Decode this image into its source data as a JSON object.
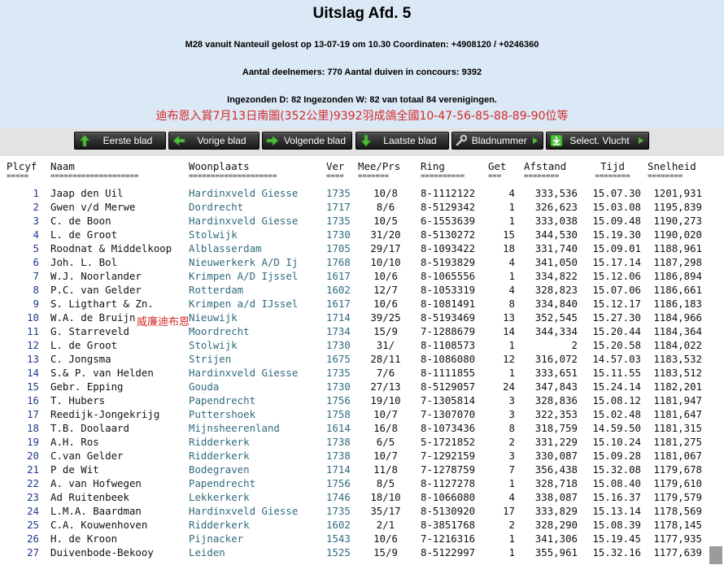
{
  "header": {
    "title": "Uitslag Afd. 5",
    "line1": "M28 vanuit Nanteuil gelost op 13-07-19 om 10.30 Coordinaten: +4908120 / +0246360",
    "line2": "Aantal deelnemers: 770 Aantal duiven in concours: 9392",
    "line3": "Ingezonden D: 82 Ingezonden W: 82 van totaal 84 verenigingen.",
    "chinese_note": "迪布恩入賞7月13日南圖(352公里)9392羽成鴿全國10-47-56-85-88-89-90位等"
  },
  "nav": {
    "first": "Eerste blad",
    "prev": "Vorige blad",
    "next": "Volgende blad",
    "last": "Laatste blad",
    "page_number": "Bladnummer",
    "select_flight": "Select. Vlucht"
  },
  "columns": {
    "headers": [
      "Plcyf",
      "Naam",
      "Woonplaats",
      "Ver",
      "Mee/Prs",
      "Ring",
      "Get",
      "Afstand",
      "Tijd",
      "Snelheid"
    ],
    "separators": [
      "=====",
      "====================",
      "====================",
      "====",
      "=======",
      "==========",
      "===",
      "========",
      "========",
      "========"
    ]
  },
  "rows": [
    [
      "1",
      "Jaap den Uil",
      "Hardinxveld Giesse",
      "1735",
      "10/8",
      "8-1112122",
      "4",
      "333,536",
      "15.07.30",
      "1201,931"
    ],
    [
      "2",
      "Gwen v/d Merwe",
      "Dordrecht",
      "1717",
      "8/6",
      "8-5129342",
      "1",
      "326,623",
      "15.03.08",
      "1195,839"
    ],
    [
      "3",
      "C. de Boon",
      "Hardinxveld Giesse",
      "1735",
      "10/5",
      "6-1553639",
      "1",
      "333,038",
      "15.09.48",
      "1190,273"
    ],
    [
      "4",
      "L. de Groot",
      "Stolwijk",
      "1730",
      "31/20",
      "8-5130272",
      "15",
      "344,530",
      "15.19.30",
      "1190,020"
    ],
    [
      "5",
      "Roodnat & Middelkoop",
      "Alblasserdam",
      "1705",
      "29/17",
      "8-1093422",
      "18",
      "331,740",
      "15.09.01",
      "1188,961"
    ],
    [
      "6",
      "Joh. L. Bol",
      "Nieuwerkerk A/D Ij",
      "1768",
      "10/10",
      "8-5193829",
      "4",
      "341,050",
      "15.17.14",
      "1187,298"
    ],
    [
      "7",
      "W.J. Noorlander",
      "Krimpen A/D Ijssel",
      "1617",
      "10/6",
      "8-1065556",
      "1",
      "334,822",
      "15.12.06",
      "1186,894"
    ],
    [
      "8",
      "P.C. van Gelder",
      "Rotterdam",
      "1602",
      "12/7",
      "8-1053319",
      "4",
      "328,823",
      "15.07.06",
      "1186,661"
    ],
    [
      "9",
      "S. Ligthart & Zn.",
      "Krimpen a/d IJssel",
      "1617",
      "10/6",
      "8-1081491",
      "8",
      "334,840",
      "15.12.17",
      "1186,183"
    ],
    [
      "10",
      "W.A. de Bruijn",
      "Nieuwijk",
      "1714",
      "39/25",
      "8-5193469",
      "13",
      "352,545",
      "15.27.30",
      "1184,966"
    ],
    [
      "11",
      "G. Starreveld",
      "Moordrecht",
      "1734",
      "15/9",
      "7-1288679",
      "14",
      "344,334",
      "15.20.44",
      "1184,364"
    ],
    [
      "12",
      "L. de Groot",
      "Stolwijk",
      "1730",
      "31/",
      "8-1108573",
      "1",
      "2",
      "15.20.58",
      "1184,022"
    ],
    [
      "13",
      "C. Jongsma",
      "Strijen",
      "1675",
      "28/11",
      "8-1086080",
      "12",
      "316,072",
      "14.57.03",
      "1183,532"
    ],
    [
      "14",
      "S.& P. van Helden",
      "Hardinxveld Giesse",
      "1735",
      "7/6",
      "8-1111855",
      "1",
      "333,651",
      "15.11.55",
      "1183,512"
    ],
    [
      "15",
      "Gebr. Epping",
      "Gouda",
      "1730",
      "27/13",
      "8-5129057",
      "24",
      "347,843",
      "15.24.14",
      "1182,201"
    ],
    [
      "16",
      "T. Hubers",
      "Papendrecht",
      "1756",
      "19/10",
      "7-1305814",
      "3",
      "328,836",
      "15.08.12",
      "1181,947"
    ],
    [
      "17",
      "Reedijk-Jongekrijg",
      "Puttershoek",
      "1758",
      "10/7",
      "7-1307070",
      "3",
      "322,353",
      "15.02.48",
      "1181,647"
    ],
    [
      "18",
      "T.B. Doolaard",
      "Mijnsheerenland",
      "1614",
      "16/8",
      "8-1073436",
      "8",
      "318,759",
      "14.59.50",
      "1181,315"
    ],
    [
      "19",
      "A.H. Ros",
      "Ridderkerk",
      "1738",
      "6/5",
      "5-1721852",
      "2",
      "331,229",
      "15.10.24",
      "1181,275"
    ],
    [
      "20",
      "C.van Gelder",
      "Ridderkerk",
      "1738",
      "10/7",
      "7-1292159",
      "3",
      "330,087",
      "15.09.28",
      "1181,067"
    ],
    [
      "21",
      "P de Wit",
      "Bodegraven",
      "1714",
      "11/8",
      "7-1278759",
      "7",
      "356,438",
      "15.32.08",
      "1179,678"
    ],
    [
      "22",
      "A. van Hofwegen",
      "Papendrecht",
      "1756",
      "8/5",
      "8-1127278",
      "1",
      "328,718",
      "15.08.40",
      "1179,610"
    ],
    [
      "23",
      "Ad Ruitenbeek",
      "Lekkerkerk",
      "1746",
      "18/10",
      "8-1066080",
      "4",
      "338,087",
      "15.16.37",
      "1179,579"
    ],
    [
      "24",
      "L.M.A. Baardman",
      "Hardinxveld Giesse",
      "1735",
      "35/17",
      "8-5130920",
      "17",
      "333,829",
      "15.13.14",
      "1178,569"
    ],
    [
      "25",
      "C.A. Kouwenhoven",
      "Ridderkerk",
      "1602",
      "2/1",
      "8-3851768",
      "2",
      "328,290",
      "15.08.39",
      "1178,145"
    ],
    [
      "26",
      "H. de Kroon",
      "Pijnacker",
      "1543",
      "10/6",
      "7-1216316",
      "1",
      "341,306",
      "15.19.45",
      "1177,935"
    ],
    [
      "27",
      "Duivenbode-Bekooy",
      "Leiden",
      "1525",
      "15/9",
      "8-5122997",
      "1",
      "355,961",
      "15.32.16",
      "1177,639"
    ]
  ],
  "overlay": {
    "chinese_name": "威廉迪布恩"
  },
  "colors": {
    "header_bg": "#dbe8f5",
    "nav_bg": "#e3e3e3",
    "button_bg": "#262626",
    "icon_green": "#4fbf3a",
    "teal_text": "#2f6a7d",
    "red_text": "#d42a2a"
  }
}
